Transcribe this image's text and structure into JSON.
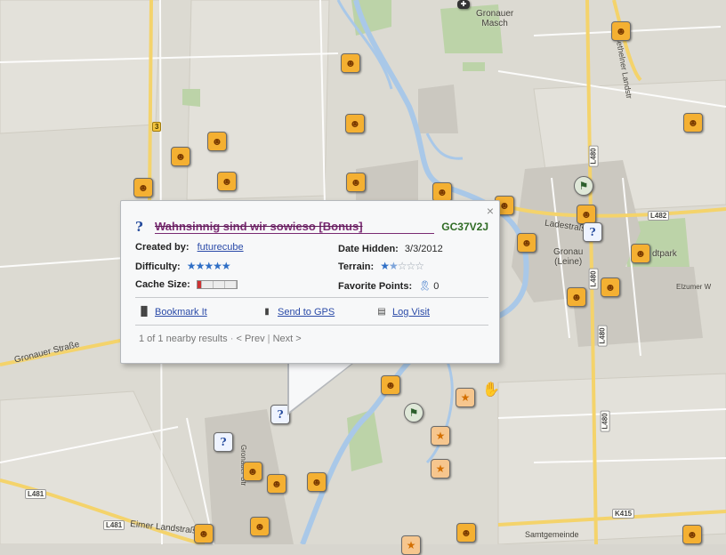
{
  "map": {
    "labels": {
      "gronauer_masch": "Gronauer\nMasch",
      "gronauer_strasse": "Gronauer Straße",
      "ladestrasse": "Ladestraße",
      "gronau_leine": "Gronau\n(Leine)",
      "elzumer": "Elzumer W",
      "eimer_landstrasse": "Eimer Landstraße",
      "betheln": "Bethelner Landstr",
      "samtgemeinde": "Samtgemeinde",
      "stadtpark": "dtpark",
      "gronauer_str_v": "Gronauer Str"
    },
    "road_shields": {
      "r3": "3",
      "r3b": "3",
      "l480a": "L480",
      "l480b": "L480",
      "l480c": "L480",
      "l480d": "L480",
      "l482": "L482",
      "l481": "L481",
      "l481b": "L481",
      "k415": "K415"
    },
    "icons": {
      "traditional": "smiley-icon",
      "mystery": "question-mark-icon",
      "event": "star-icon",
      "multi": "multi-cache-icon"
    }
  },
  "popup": {
    "cache_type_icon": "mystery-cache-icon",
    "title": "Wahnsinnig sind wir sowieso [Bonus]",
    "gc_code": "GC37V2J",
    "close_symbol": "×",
    "created_by_label": "Created by:",
    "created_by_value": "futurecube",
    "date_hidden_label": "Date Hidden:",
    "date_hidden_value": "3/3/2012",
    "difficulty_label": "Difficulty:",
    "difficulty_rating": 5,
    "terrain_label": "Terrain:",
    "terrain_rating": 1.5,
    "cache_size_label": "Cache Size:",
    "favorite_points_label": "Favorite Points:",
    "favorite_points_value": "0",
    "actions": {
      "bookmark": "Bookmark It",
      "send_gps": "Send to GPS",
      "log_visit": "Log Visit"
    },
    "pager": {
      "results": "1 of 1 nearby results",
      "prev": "< Prev",
      "next": "Next >"
    }
  },
  "colors": {
    "title": "#7a2a72",
    "gc_code": "#2f6b24",
    "link": "#2a4aa8",
    "star": "#2f6fc6"
  }
}
